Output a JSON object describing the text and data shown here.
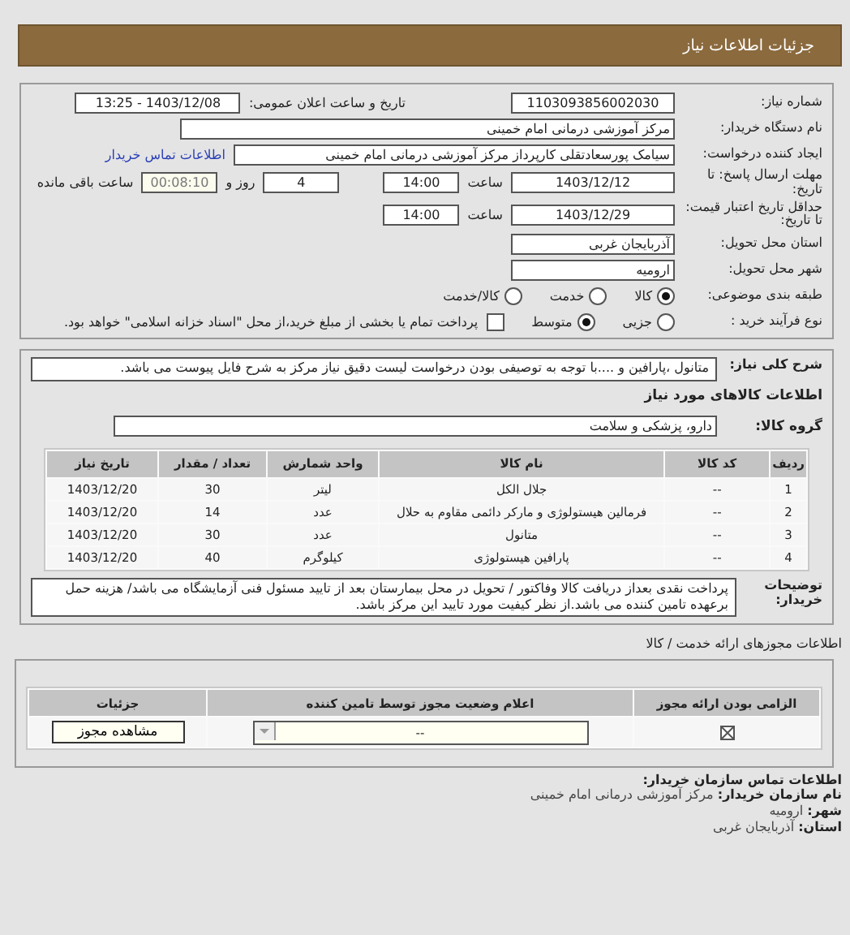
{
  "header": {
    "title": "جزئیات اطلاعات نیاز"
  },
  "need_number": {
    "label": "شماره نیاز:",
    "value": "1103093856002030"
  },
  "announce": {
    "label": "تاریخ و ساعت اعلان عمومی:",
    "value": "1403/12/08 - 13:25"
  },
  "buyer": {
    "label": "نام دستگاه خریدار:",
    "value": "مرکز آموزشی درمانی امام خمینی"
  },
  "creator": {
    "label": "ایجاد کننده درخواست:",
    "value": "سیامک پورسعادتقلی کارپرداز مرکز آموزشی درمانی امام خمینی",
    "link": "اطلاعات تماس خریدار"
  },
  "deadline": {
    "label": "مهلت ارسال پاسخ: تا تاریخ:",
    "date": "1403/12/12",
    "time_label": "ساعت",
    "time": "14:00",
    "days": "4",
    "days_label": "روز و",
    "remaining": "00:08:10",
    "remaining_label": "ساعت باقی مانده"
  },
  "validity": {
    "label": "حداقل تاریخ اعتبار قیمت: تا تاریخ:",
    "date": "1403/12/29",
    "time_label": "ساعت",
    "time": "14:00"
  },
  "province": {
    "label": "استان محل تحویل:",
    "value": "آذربایجان غربی"
  },
  "city": {
    "label": "شهر محل تحویل:",
    "value": "ارومیه"
  },
  "category": {
    "label": "طبقه بندی موضوعی:",
    "options": [
      {
        "label": "کالا",
        "selected": true
      },
      {
        "label": "خدمت",
        "selected": false
      },
      {
        "label": "کالا/خدمت",
        "selected": false
      }
    ]
  },
  "process": {
    "label": "نوع فرآیند خرید :",
    "options": [
      {
        "label": "جزیی",
        "selected": false
      },
      {
        "label": "متوسط",
        "selected": true
      }
    ],
    "treasury": {
      "checked": false,
      "label": "پرداخت تمام یا بخشی از مبلغ خرید،از محل \"اسناد خزانه اسلامی\" خواهد بود."
    }
  },
  "description": {
    "label": "شرح کلی نیاز:",
    "value": "متانول ،پارافین و ....با توجه به توصیفی بودن درخواست لیست دقیق نیاز مرکز به شرح فایل پیوست می باشد."
  },
  "goods_heading": "اطلاعات کالاهای مورد نیاز",
  "goods_group": {
    "label": "گروه کالا:",
    "value": "دارو، پزشکی و سلامت"
  },
  "goods_table": {
    "columns": [
      "ردیف",
      "کد کالا",
      "نام کالا",
      "واحد شمارش",
      "تعداد / مقدار",
      "تاریخ نیاز"
    ],
    "rows": [
      [
        "1",
        "--",
        "جلال الکل",
        "لیتر",
        "30",
        "1403/12/20"
      ],
      [
        "2",
        "--",
        "فرمالین هیستولوژی و مارکر دائمی مقاوم به حلال",
        "عدد",
        "14",
        "1403/12/20"
      ],
      [
        "3",
        "--",
        "متانول",
        "عدد",
        "30",
        "1403/12/20"
      ],
      [
        "4",
        "--",
        "پارافین هیستولوژی",
        "کیلوگرم",
        "40",
        "1403/12/20"
      ]
    ]
  },
  "buyer_notes": {
    "label": "توضیحات خریدار:",
    "value": "پرداخت نقدی بعداز دریافت کالا وفاکتور / تحویل در محل بیمارستان بعد از تایید مسئول فنی آزمایشگاه می باشد/ هزینه حمل برعهده تامین کننده می باشد.از نظر کیفیت مورد تایید این مرکز باشد."
  },
  "permits_heading": "اطلاعات مجوزهای ارائه خدمت / کالا",
  "permits_table": {
    "columns": [
      "الزامی بودن ارائه مجوز",
      "اعلام وضعیت مجوز توسط تامین کننده",
      "جزئیات"
    ],
    "rows": [
      {
        "required": true,
        "status": "--",
        "button": "مشاهده مجوز"
      }
    ]
  },
  "contact": {
    "heading": "اطلاعات تماس سازمان خریدار:",
    "lines": [
      {
        "label": "نام سازمان خریدار:",
        "value": "مرکز آموزشی درمانی امام خمینی"
      },
      {
        "label": "شهر:",
        "value": "ارومیه"
      },
      {
        "label": "استان:",
        "value": "آذربایجان غربی"
      }
    ]
  }
}
